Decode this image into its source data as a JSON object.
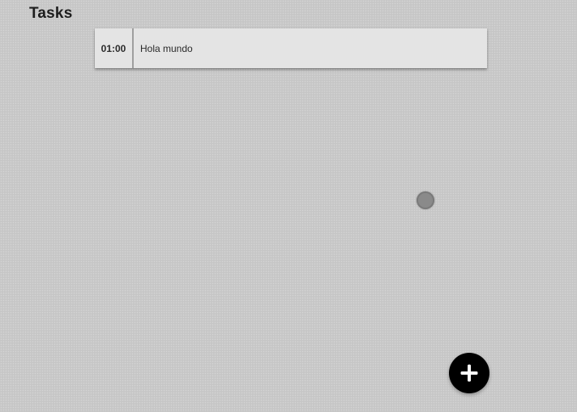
{
  "header": {
    "title": "Tasks"
  },
  "tasks": [
    {
      "time": "01:00",
      "title": "Hola mundo"
    }
  ],
  "fab": {
    "icon": "plus-icon"
  }
}
